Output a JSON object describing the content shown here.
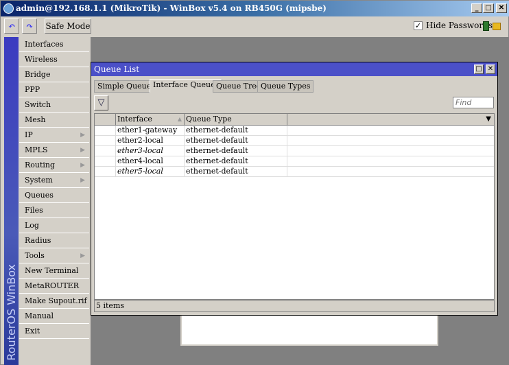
{
  "window": {
    "title": "admin@192.168.1.1 (MikroTik) - WinBox v5.4 on RB450G (mipsbe)"
  },
  "toolbar": {
    "undo": "undo-icon",
    "redo": "redo-icon",
    "safe_mode": "Safe Mode",
    "hide_passwords": "Hide Passwords",
    "hide_passwords_checked": true
  },
  "sidebar": {
    "brand": "RouterOS WinBox",
    "items": [
      {
        "label": "Interfaces"
      },
      {
        "label": "Wireless"
      },
      {
        "label": "Bridge"
      },
      {
        "label": "PPP"
      },
      {
        "label": "Switch"
      },
      {
        "label": "Mesh"
      },
      {
        "label": "IP",
        "sub": true
      },
      {
        "label": "MPLS",
        "sub": true
      },
      {
        "label": "Routing",
        "sub": true
      },
      {
        "label": "System",
        "sub": true
      },
      {
        "label": "Queues"
      },
      {
        "label": "Files"
      },
      {
        "label": "Log"
      },
      {
        "label": "Radius"
      },
      {
        "label": "Tools",
        "sub": true
      },
      {
        "label": "New Terminal"
      },
      {
        "label": "MetaROUTER"
      },
      {
        "label": "Make Supout.rif"
      },
      {
        "label": "Manual"
      },
      {
        "label": "Exit"
      }
    ]
  },
  "queue_list": {
    "title": "Queue List",
    "tabs": [
      "Simple Queues",
      "Interface Queues",
      "Queue Tree",
      "Queue Types"
    ],
    "active_tab": 1,
    "find_placeholder": "Find",
    "columns": [
      "Interface",
      "Queue Type"
    ],
    "rows": [
      {
        "interface": "ether1-gateway",
        "queue_type": "ethernet-default",
        "italic": false
      },
      {
        "interface": "ether2-local",
        "queue_type": "ethernet-default",
        "italic": false
      },
      {
        "interface": "ether3-local",
        "queue_type": "ethernet-default",
        "italic": true
      },
      {
        "interface": "ether4-local",
        "queue_type": "ethernet-default",
        "italic": false
      },
      {
        "interface": "ether5-local",
        "queue_type": "ethernet-default",
        "italic": true
      }
    ],
    "status": "5 items"
  }
}
